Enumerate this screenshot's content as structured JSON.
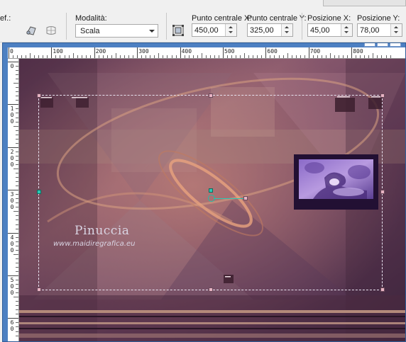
{
  "toolbar": {
    "cut_label": "ef.:",
    "mode_label": "Modalità:",
    "mode_value": "Scala",
    "center_x_label": "Punto centrale X:",
    "center_y_label": "Punto centrale Y:",
    "pos_x_label": "Posizione X:",
    "pos_y_label": "Posizione Y:",
    "center_x_value": "450,00",
    "center_y_value": "325,00",
    "pos_x_value": "45,00",
    "pos_y_value": "78,00",
    "icons": [
      "perspective-tool-icon",
      "mesh-warp-icon",
      "edit-selection-icon"
    ]
  },
  "ruler": {
    "top_labels": [
      "0",
      "100",
      "200",
      "300",
      "400",
      "500",
      "600",
      "700",
      "800"
    ],
    "left_labels": [
      [
        "0"
      ],
      [
        "1",
        "0",
        "0"
      ],
      [
        "2",
        "0",
        "0"
      ],
      [
        "3",
        "0",
        "0"
      ],
      [
        "4",
        "0",
        "0"
      ],
      [
        "5",
        "0",
        "0"
      ],
      [
        "6",
        "0"
      ]
    ]
  },
  "image": {
    "watermark_name": "Pinuccia",
    "watermark_url": "www.maidiregrafica.eu"
  },
  "colors": {
    "window_frame": "#4d80c2",
    "selection_handle": "#e8b4c4",
    "pivot_handle": "#28c9b4"
  }
}
